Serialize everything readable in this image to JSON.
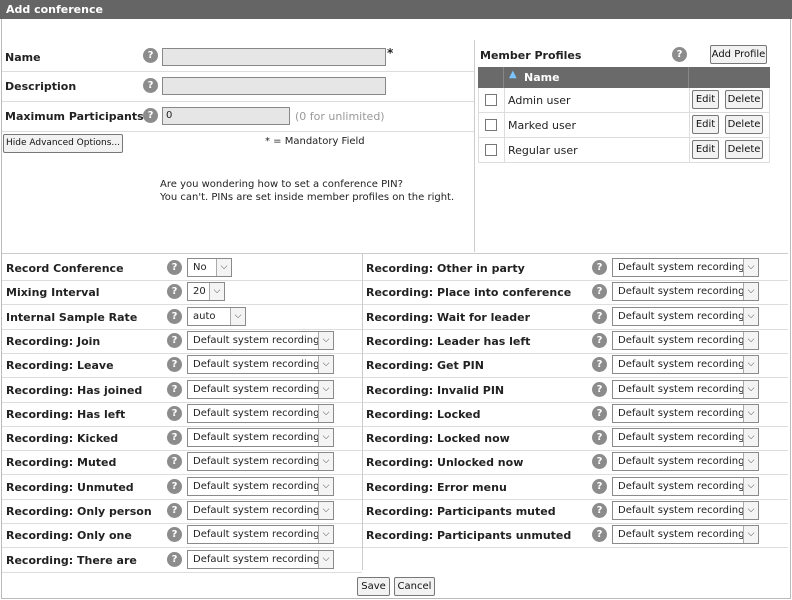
{
  "window": {
    "title": "Add conference"
  },
  "form": {
    "name_label": "Name",
    "name_value": "",
    "mandatory_star": "*",
    "description_label": "Description",
    "description_value": "",
    "max_participants_label": "Maximum Participants",
    "max_participants_value": "0",
    "max_participants_hint": "(0 for unlimited)",
    "hide_advanced_label": "Hide Advanced Options...",
    "mandatory_note": "* = Mandatory Field",
    "pin_note_line1": "Are you wondering how to set a conference PIN?",
    "pin_note_line2": "You can't. PINs are set inside member profiles on the right.",
    "help_glyph": "?"
  },
  "member_profiles": {
    "title": "Member Profiles",
    "add_label": "Add Profile",
    "column_name": "Name",
    "edit_label": "Edit",
    "delete_label": "Delete",
    "rows": [
      "Admin user",
      "Marked user",
      "Regular user"
    ]
  },
  "advanced": {
    "left": [
      {
        "label": "Record Conference",
        "value": "No"
      },
      {
        "label": "Mixing Interval",
        "value": "20"
      },
      {
        "label": "Internal Sample Rate",
        "value": "auto"
      },
      {
        "label": "Recording: Join",
        "value": "Default system recording"
      },
      {
        "label": "Recording: Leave",
        "value": "Default system recording"
      },
      {
        "label": "Recording: Has joined",
        "value": "Default system recording"
      },
      {
        "label": "Recording: Has left",
        "value": "Default system recording"
      },
      {
        "label": "Recording: Kicked",
        "value": "Default system recording"
      },
      {
        "label": "Recording: Muted",
        "value": "Default system recording"
      },
      {
        "label": "Recording: Unmuted",
        "value": "Default system recording"
      },
      {
        "label": "Recording: Only person",
        "value": "Default system recording"
      },
      {
        "label": "Recording: Only one",
        "value": "Default system recording"
      },
      {
        "label": "Recording: There are",
        "value": "Default system recording"
      }
    ],
    "right": [
      {
        "label": "Recording: Other in party",
        "value": "Default system recording"
      },
      {
        "label": "Recording: Place into conference",
        "value": "Default system recording"
      },
      {
        "label": "Recording: Wait for leader",
        "value": "Default system recording"
      },
      {
        "label": "Recording: Leader has left",
        "value": "Default system recording"
      },
      {
        "label": "Recording: Get PIN",
        "value": "Default system recording"
      },
      {
        "label": "Recording: Invalid PIN",
        "value": "Default system recording"
      },
      {
        "label": "Recording: Locked",
        "value": "Default system recording"
      },
      {
        "label": "Recording: Locked now",
        "value": "Default system recording"
      },
      {
        "label": "Recording: Unlocked now",
        "value": "Default system recording"
      },
      {
        "label": "Recording: Error menu",
        "value": "Default system recording"
      },
      {
        "label": "Recording: Participants muted",
        "value": "Default system recording"
      },
      {
        "label": "Recording: Participants unmuted",
        "value": "Default system recording"
      }
    ]
  },
  "footer": {
    "save_label": "Save",
    "cancel_label": "Cancel"
  }
}
